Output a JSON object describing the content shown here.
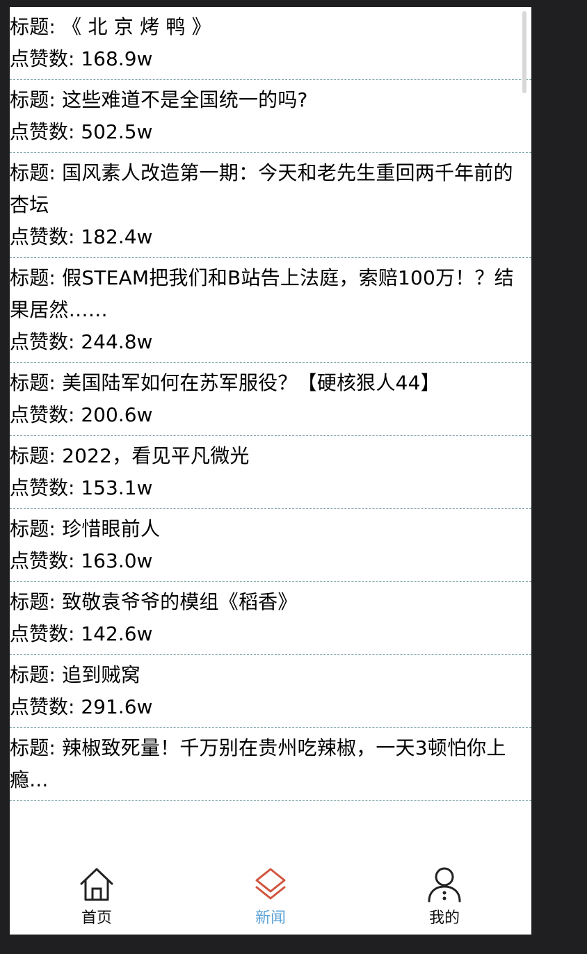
{
  "title_prefix": "标题: ",
  "likes_prefix": "点赞数: ",
  "news": [
    {
      "title": "《 北 京 烤 鸭 》",
      "likes": "168.9w"
    },
    {
      "title": "这些难道不是全国统一的吗?",
      "likes": "502.5w"
    },
    {
      "title": "国风素人改造第一期：今天和老先生重回两千年前的杏坛",
      "likes": "182.4w"
    },
    {
      "title": "假STEAM把我们和B站告上法庭，索赔100万！？结果居然……",
      "likes": "244.8w"
    },
    {
      "title": "美国陆军如何在苏军服役？【硬核狠人44】",
      "likes": "200.6w"
    },
    {
      "title": "2022，看见平凡微光",
      "likes": "153.1w"
    },
    {
      "title": "珍惜眼前人",
      "likes": "163.0w"
    },
    {
      "title": "致敬袁爷爷的模组《稻香》",
      "likes": "142.6w"
    },
    {
      "title": "追到贼窝",
      "likes": "291.6w"
    },
    {
      "title": "辣椒致死量！千万别在贵州吃辣椒，一天3顿怕你上瘾...",
      "likes": ""
    }
  ],
  "tabbar": {
    "tabs": [
      {
        "label": "首页",
        "icon": "home-icon"
      },
      {
        "label": "新闻",
        "icon": "layers-icon",
        "active": true
      },
      {
        "label": "我的",
        "icon": "user-icon"
      }
    ],
    "active_color": "#5ea3d7",
    "accent_icon_color": "#d1563f"
  }
}
